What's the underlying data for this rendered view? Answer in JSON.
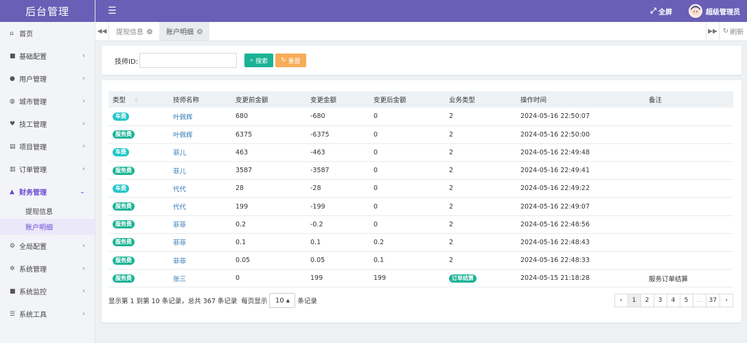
{
  "brand": "后台管理",
  "header": {
    "fullscreen": "全屏",
    "user": "超级管理员"
  },
  "sidebar": {
    "items": [
      {
        "icon": "home-icon",
        "glyph": "⌂",
        "label": "首页",
        "chevron": false
      },
      {
        "icon": "bookmark-icon",
        "glyph": "■",
        "label": "基础配置",
        "chevron": true
      },
      {
        "icon": "user-icon",
        "glyph": "●",
        "label": "用户管理",
        "chevron": true
      },
      {
        "icon": "globe-icon",
        "glyph": "◍",
        "label": "城市管理",
        "chevron": true
      },
      {
        "icon": "heart-icon",
        "glyph": "♥",
        "label": "技工管理",
        "chevron": true
      },
      {
        "icon": "book-icon",
        "glyph": "▤",
        "label": "项目管理",
        "chevron": true
      },
      {
        "icon": "bar-chart-icon",
        "glyph": "▥",
        "label": "订单管理",
        "chevron": true
      },
      {
        "icon": "area-chart-icon",
        "glyph": "▲",
        "label": "财务管理",
        "chevron": true,
        "active": true
      }
    ],
    "finance_sub": [
      {
        "label": "提现信息",
        "active": false
      },
      {
        "label": "账户明细",
        "active": true
      }
    ],
    "items_after": [
      {
        "icon": "cogs-icon",
        "glyph": "⚙",
        "label": "全局配置",
        "chevron": true
      },
      {
        "icon": "gear-icon",
        "glyph": "✲",
        "label": "系统管理",
        "chevron": true
      },
      {
        "icon": "video-camera-icon",
        "glyph": "■",
        "label": "系统监控",
        "chevron": true
      },
      {
        "icon": "bars-icon",
        "glyph": "☰",
        "label": "系统工具",
        "chevron": true
      }
    ]
  },
  "tabs": [
    {
      "label": "提现信息",
      "active": false
    },
    {
      "label": "账户明细",
      "active": true
    }
  ],
  "refresh_label": "刷新",
  "search": {
    "label": "技师ID:",
    "value": "",
    "search_btn": "搜索",
    "reset_btn": "重置"
  },
  "table": {
    "columns": [
      "类型",
      "技师名称",
      "变更前金额",
      "变更金额",
      "变更后金额",
      "业务类型",
      "操作时间",
      "备注"
    ],
    "rows": [
      {
        "type": "车费",
        "kind": "car",
        "name": "叶佩辉",
        "before": "680",
        "change": "-680",
        "after": "0",
        "biz": "2",
        "biz_badge": false,
        "time": "2024-05-16 22:50:07",
        "note": ""
      },
      {
        "type": "服务费",
        "kind": "svc",
        "name": "叶佩辉",
        "before": "6375",
        "change": "-6375",
        "after": "0",
        "biz": "2",
        "biz_badge": false,
        "time": "2024-05-16 22:50:00",
        "note": ""
      },
      {
        "type": "车费",
        "kind": "car",
        "name": "菲儿",
        "before": "463",
        "change": "-463",
        "after": "0",
        "biz": "2",
        "biz_badge": false,
        "time": "2024-05-16 22:49:48",
        "note": ""
      },
      {
        "type": "服务费",
        "kind": "svc",
        "name": "菲儿",
        "before": "3587",
        "change": "-3587",
        "after": "0",
        "biz": "2",
        "biz_badge": false,
        "time": "2024-05-16 22:49:41",
        "note": ""
      },
      {
        "type": "车费",
        "kind": "car",
        "name": "代代",
        "before": "28",
        "change": "-28",
        "after": "0",
        "biz": "2",
        "biz_badge": false,
        "time": "2024-05-16 22:49:22",
        "note": ""
      },
      {
        "type": "服务费",
        "kind": "svc",
        "name": "代代",
        "before": "199",
        "change": "-199",
        "after": "0",
        "biz": "2",
        "biz_badge": false,
        "time": "2024-05-16 22:49:07",
        "note": ""
      },
      {
        "type": "服务费",
        "kind": "svc",
        "name": "菲菲",
        "before": "0.2",
        "change": "-0.2",
        "after": "0",
        "biz": "2",
        "biz_badge": false,
        "time": "2024-05-16 22:48:56",
        "note": ""
      },
      {
        "type": "服务费",
        "kind": "svc",
        "name": "菲菲",
        "before": "0.1",
        "change": "0.1",
        "after": "0.2",
        "biz": "2",
        "biz_badge": false,
        "time": "2024-05-16 22:48:43",
        "note": ""
      },
      {
        "type": "服务费",
        "kind": "svc",
        "name": "菲菲",
        "before": "0.05",
        "change": "0.05",
        "after": "0.1",
        "biz": "2",
        "biz_badge": false,
        "time": "2024-05-16 22:48:33",
        "note": ""
      },
      {
        "type": "服务费",
        "kind": "svc",
        "name": "张三",
        "before": "0",
        "change": "199",
        "after": "199",
        "biz": "订单结算",
        "biz_badge": true,
        "time": "2024-05-15 21:18:28",
        "note": "服务订单结算"
      }
    ]
  },
  "footer": {
    "summary": "显示第 1 到第 10 条记录，总共 367 条记录",
    "per_page_label": "每页显示",
    "page_size": "10 ▴",
    "records_label": "条记录"
  },
  "pager": [
    "‹",
    "1",
    "2",
    "3",
    "4",
    "5",
    "...",
    "37",
    "›"
  ],
  "colors": {
    "primary": "#6a5fb6",
    "green": "#1ab394",
    "cyan": "#23c6c8",
    "orange": "#f8ac59",
    "link": "#337ab7"
  }
}
